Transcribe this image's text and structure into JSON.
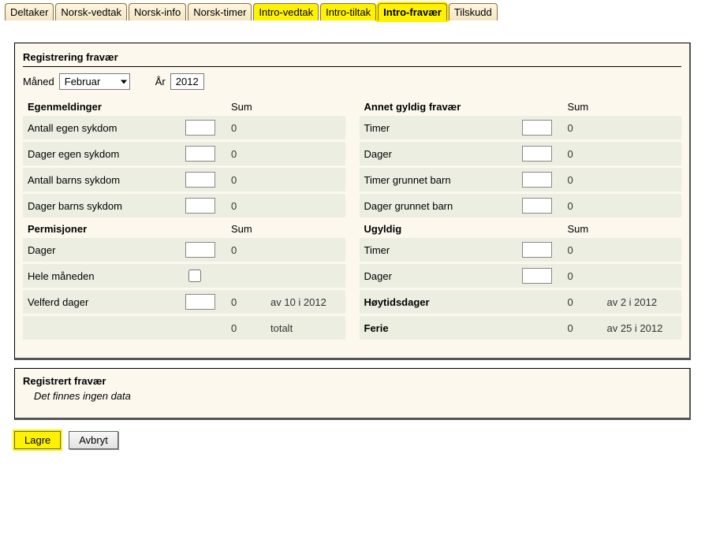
{
  "tabs": [
    {
      "label": "Deltaker",
      "hl": false
    },
    {
      "label": "Norsk-vedtak",
      "hl": false
    },
    {
      "label": "Norsk-info",
      "hl": false
    },
    {
      "label": "Norsk-timer",
      "hl": false
    },
    {
      "label": "Intro-vedtak",
      "hl": true
    },
    {
      "label": "Intro-tiltak",
      "hl": true
    },
    {
      "label": "Intro-fravær",
      "hl": true,
      "strong": true
    },
    {
      "label": "Tilskudd",
      "hl": false
    }
  ],
  "panel": {
    "title": "Registrering fravær",
    "month_label": "Måned",
    "month_value": "Februar",
    "year_label": "År",
    "year_value": "2012",
    "sum_label": "Sum",
    "sections": {
      "egen": {
        "title": "Egenmeldinger",
        "rows": [
          {
            "lbl": "Antall egen sykdom",
            "val": "",
            "sum": "0"
          },
          {
            "lbl": "Dager egen sykdom",
            "val": "",
            "sum": "0"
          },
          {
            "lbl": "Antall barns sykdom",
            "val": "",
            "sum": "0"
          },
          {
            "lbl": "Dager barns sykdom",
            "val": "",
            "sum": "0"
          }
        ]
      },
      "annet": {
        "title": "Annet gyldig fravær",
        "rows": [
          {
            "lbl": "Timer",
            "val": "",
            "sum": "0"
          },
          {
            "lbl": "Dager",
            "val": "",
            "sum": "0"
          },
          {
            "lbl": "Timer grunnet barn",
            "val": "",
            "sum": "0"
          },
          {
            "lbl": "Dager grunnet barn",
            "val": "",
            "sum": "0"
          }
        ]
      },
      "perm": {
        "title": "Permisjoner",
        "rows": [
          {
            "lbl": "Dager",
            "type": "text",
            "val": "",
            "sum": "0"
          },
          {
            "lbl": "Hele måneden",
            "type": "check",
            "val": "",
            "sum": ""
          },
          {
            "lbl": "Velferd dager",
            "type": "text",
            "val": "",
            "sum": "0",
            "extra": "av 10 i 2012"
          },
          {
            "lbl": "",
            "type": "none",
            "val": "",
            "sum": "0",
            "extra": "totalt"
          }
        ]
      },
      "ugyld": {
        "title": "Ugyldig",
        "rows": [
          {
            "lbl": "Timer",
            "type": "text",
            "val": "",
            "sum": "0"
          },
          {
            "lbl": "Dager",
            "type": "text",
            "val": "",
            "sum": "0"
          },
          {
            "lbl": "Høytidsdager",
            "type": "none",
            "bold": true,
            "val": "",
            "sum": "0",
            "extra": "av 2 i 2012"
          },
          {
            "lbl": "Ferie",
            "type": "none",
            "bold": true,
            "val": "",
            "sum": "0",
            "extra": "av 25 i 2012"
          }
        ]
      }
    }
  },
  "panel2": {
    "title": "Registrert fravær",
    "nodata": "Det finnes ingen data"
  },
  "buttons": {
    "save": "Lagre",
    "cancel": "Avbryt"
  }
}
